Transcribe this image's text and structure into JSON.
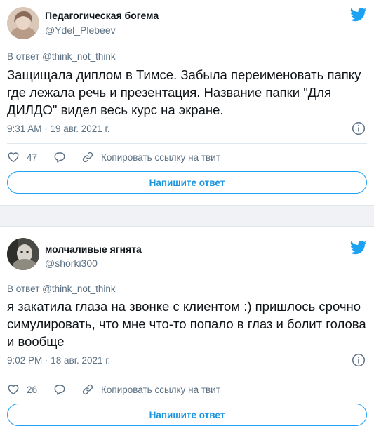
{
  "tweets": [
    {
      "author_name": "Педагогическая богема",
      "author_handle": "@Ydel_Plebeev",
      "reply_to": "В ответ @think_not_think",
      "text": "Защищала диплом в Тимсе. Забыла переименовать папку где лежала речь и презентация. Название папки \"Для ДИЛДО\" видел весь курс на экране.",
      "timestamp": "9:31 AM · 19 авг. 2021 г.",
      "likes": "47",
      "copy_link_label": "Копировать ссылку на твит",
      "reply_button_label": "Напишите ответ"
    },
    {
      "author_name": "молчаливые ягнята",
      "author_handle": "@shorki300",
      "reply_to": "В ответ @think_not_think",
      "text": "я закатила глаза на звонке с клиентом :) пришлось срочно симулировать, что мне что-то попало в глаз и болит голова и вообще",
      "timestamp": "9:02 PM · 18 авг. 2021 г.",
      "likes": "26",
      "copy_link_label": "Копировать ссылку на твит",
      "reply_button_label": "Напишите ответ"
    }
  ],
  "icons": {
    "brand": "twitter-bird-icon",
    "info": "info-icon",
    "like": "heart-icon",
    "reply": "speech-bubble-icon",
    "link": "link-icon"
  },
  "colors": {
    "twitter_blue": "#1da1f2",
    "secondary_text": "#5b7083",
    "separator_bg": "#f0f2f5"
  }
}
